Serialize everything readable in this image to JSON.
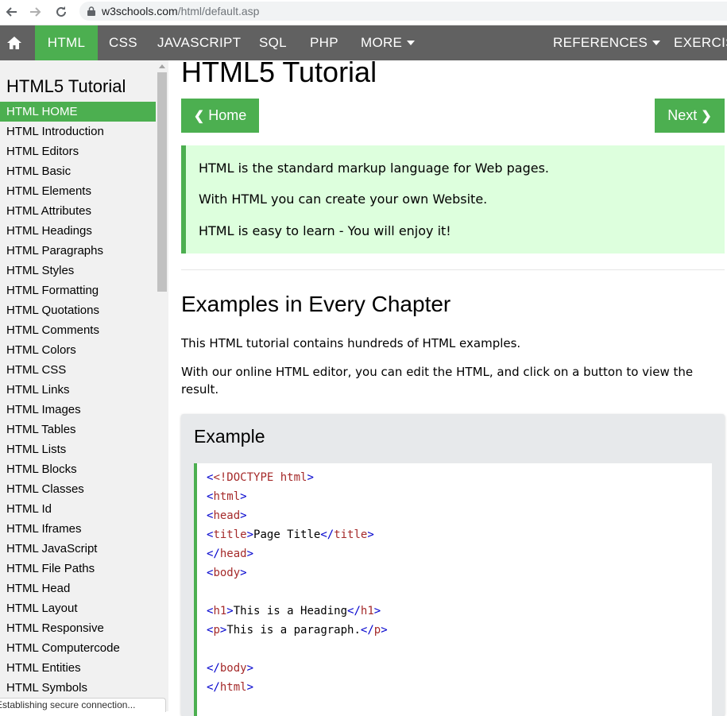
{
  "browser": {
    "url_host": "w3schools.com",
    "url_path": "/html/default.asp"
  },
  "topnav": {
    "items": [
      "HTML",
      "CSS",
      "JAVASCRIPT",
      "SQL",
      "PHP",
      "MORE"
    ],
    "right_items": [
      "REFERENCES",
      "EXERCIS"
    ]
  },
  "sidebar": {
    "title": "HTML5 Tutorial",
    "items": [
      "HTML HOME",
      "HTML Introduction",
      "HTML Editors",
      "HTML Basic",
      "HTML Elements",
      "HTML Attributes",
      "HTML Headings",
      "HTML Paragraphs",
      "HTML Styles",
      "HTML Formatting",
      "HTML Quotations",
      "HTML Comments",
      "HTML Colors",
      "HTML CSS",
      "HTML Links",
      "HTML Images",
      "HTML Tables",
      "HTML Lists",
      "HTML Blocks",
      "HTML Classes",
      "HTML Id",
      "HTML Iframes",
      "HTML JavaScript",
      "HTML File Paths",
      "HTML Head",
      "HTML Layout",
      "HTML Responsive",
      "HTML Computercode",
      "HTML Entities",
      "HTML Symbols"
    ]
  },
  "status_text": "Establishing secure connection...",
  "main": {
    "title": "HTML5 Tutorial",
    "home_label": "Home",
    "next_label": "Next",
    "intro": [
      "HTML is the standard markup language for Web pages.",
      "With HTML you can create your own Website.",
      "HTML is easy to learn - You will enjoy it!"
    ],
    "h2": "Examples in Every Chapter",
    "p1": "This HTML tutorial contains hundreds of HTML examples.",
    "p2": "With our online HTML editor, you can edit the HTML, and click on a button to view the result.",
    "example_title": "Example"
  },
  "code": {
    "doctype_open": "<!DOCTYPE",
    "doctype_attr": "html",
    "html_tag": "html",
    "head_tag": "head",
    "title_tag": "title",
    "title_text": "Page Title",
    "body_tag": "body",
    "h1_tag": "h1",
    "h1_text": "This is a Heading",
    "p_tag": "p",
    "p_text": "This is a paragraph."
  },
  "colors": {
    "nav_bg": "#616161",
    "accent_green": "#4caf50",
    "note_bg": "#ddffdd",
    "sidebar_bg": "#f1f1f1",
    "code_tag": "#a52a2a",
    "code_bracket": "#0000cd"
  }
}
